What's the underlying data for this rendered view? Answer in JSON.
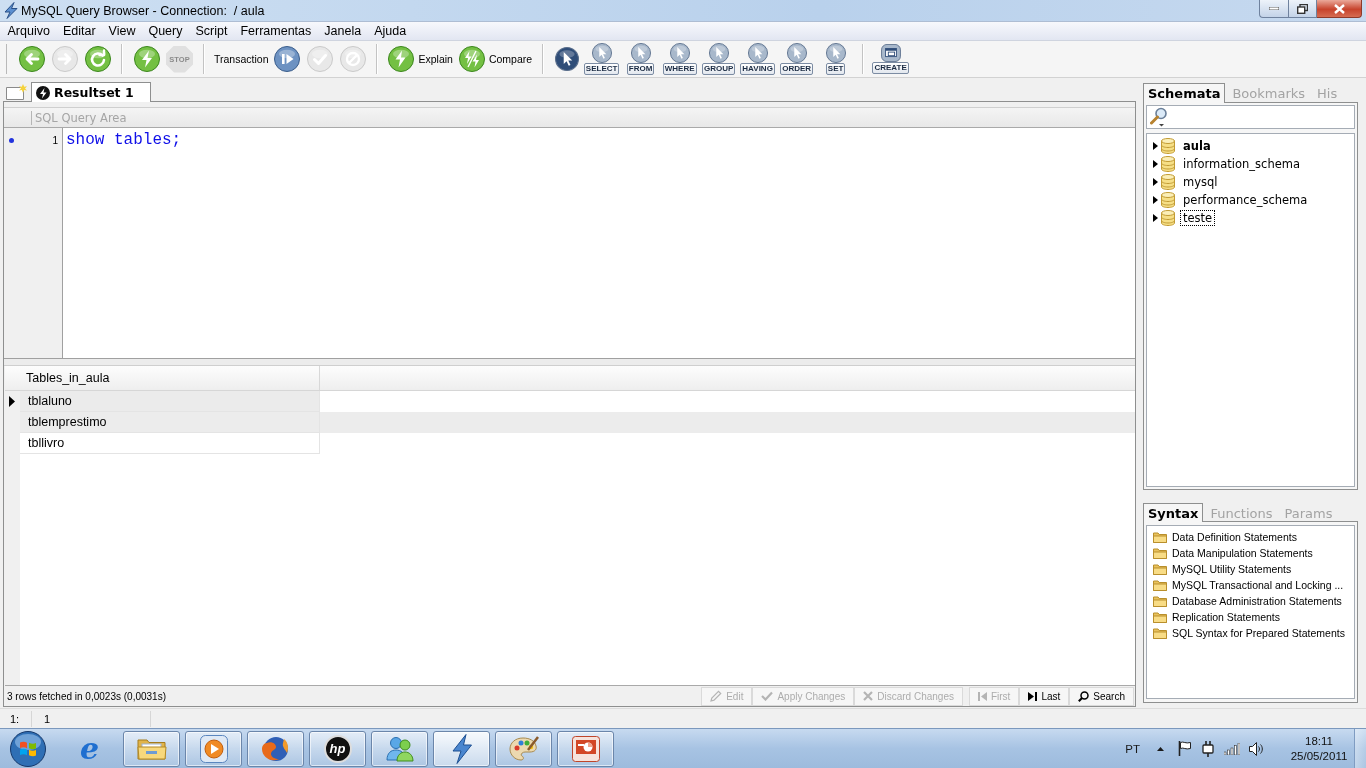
{
  "window": {
    "title": "MySQL Query Browser - Connection:  / aula"
  },
  "menu": [
    "Arquivo",
    "Editar",
    "View",
    "Query",
    "Script",
    "Ferramentas",
    "Janela",
    "Ajuda"
  ],
  "toolbar": {
    "groups": [
      [
        {
          "kind": "back",
          "disabled": false
        },
        {
          "kind": "forward",
          "disabled": true
        },
        {
          "kind": "refresh",
          "disabled": false
        }
      ],
      [
        {
          "kind": "execute",
          "disabled": false
        },
        {
          "kind": "stop",
          "badge": "STOP",
          "disabled": true
        }
      ],
      [
        {
          "kind": "text",
          "label": "Transaction"
        },
        {
          "kind": "start",
          "disabled": false
        },
        {
          "kind": "commit",
          "disabled": true
        },
        {
          "kind": "rollback",
          "disabled": true
        }
      ],
      [
        {
          "kind": "explain",
          "label": "Explain",
          "disabled": false
        },
        {
          "kind": "compare",
          "label": "Compare",
          "disabled": false
        }
      ],
      [
        {
          "kind": "pointer",
          "selected": true,
          "disabled": false
        },
        {
          "kind": "clause",
          "badge": "SELECT",
          "selected": false,
          "disabled": false
        },
        {
          "kind": "clause",
          "badge": "FROM",
          "selected": false,
          "disabled": false
        },
        {
          "kind": "clause",
          "badge": "WHERE",
          "selected": false,
          "disabled": false
        },
        {
          "kind": "clause",
          "badge": "GROUP",
          "selected": false,
          "disabled": false
        },
        {
          "kind": "clause",
          "badge": "HAVING",
          "selected": false,
          "disabled": false
        },
        {
          "kind": "clause",
          "badge": "ORDER",
          "selected": false,
          "disabled": false
        },
        {
          "kind": "clause",
          "badge": "SET",
          "selected": false,
          "disabled": false
        }
      ],
      [
        {
          "kind": "create",
          "badge": "CREATE",
          "disabled": false
        }
      ]
    ]
  },
  "result_tabs": [
    {
      "label": "Resultset 1",
      "selected": true
    }
  ],
  "query_area": {
    "header": "SQL Query Area",
    "lines": [
      {
        "number": "1",
        "text": "show tables;",
        "marked": true
      }
    ]
  },
  "result_grid": {
    "columns": [
      "Tables_in_aula"
    ],
    "rows": [
      {
        "cells": [
          "tblaluno"
        ],
        "selected": true
      },
      {
        "cells": [
          "tblemprestimo"
        ],
        "selected": false
      },
      {
        "cells": [
          "tbllivro"
        ],
        "selected": false
      }
    ]
  },
  "result_footer": {
    "status": "3 rows fetched in 0,0023s (0,0031s)",
    "buttons": [
      {
        "kind": "edit",
        "label": "Edit",
        "disabled": true
      },
      {
        "kind": "apply",
        "label": "Apply Changes",
        "disabled": true
      },
      {
        "kind": "discard",
        "label": "Discard Changes",
        "disabled": true
      },
      {
        "kind": "first",
        "label": "First",
        "disabled": true
      },
      {
        "kind": "last",
        "label": "Last",
        "disabled": false
      },
      {
        "kind": "search",
        "label": "Search",
        "disabled": false
      }
    ]
  },
  "schemata_panel": {
    "tabs": [
      {
        "label": "Schemata",
        "selected": true
      },
      {
        "label": "Bookmarks",
        "selected": false
      },
      {
        "label": "His",
        "selected": false
      }
    ],
    "tree": [
      {
        "label": "aula",
        "default": true,
        "focused": false,
        "expanded": false
      },
      {
        "label": "information_schema",
        "default": false,
        "focused": false,
        "expanded": false
      },
      {
        "label": "mysql",
        "default": false,
        "focused": false,
        "expanded": false
      },
      {
        "label": "performance_schema",
        "default": false,
        "focused": false,
        "expanded": false
      },
      {
        "label": "teste",
        "default": false,
        "focused": true,
        "expanded": false
      }
    ]
  },
  "syntax_panel": {
    "tabs": [
      {
        "label": "Syntax",
        "selected": true
      },
      {
        "label": "Functions",
        "selected": false
      },
      {
        "label": "Params",
        "selected": false
      }
    ],
    "items": [
      "Data Definition Statements",
      "Data Manipulation Statements",
      "MySQL Utility Statements",
      "MySQL Transactional and Locking ...",
      "Database Administration Statements",
      "Replication Statements",
      "SQL Syntax for Prepared Statements"
    ]
  },
  "status_bar": [
    "1:",
    "1"
  ],
  "taskbar": {
    "apps": [
      {
        "kind": "letter",
        "glyph": "e",
        "running": false,
        "active": false
      },
      {
        "kind": "folder",
        "running": true,
        "active": false
      },
      {
        "kind": "media",
        "running": true,
        "active": false
      },
      {
        "kind": "globe",
        "running": true,
        "active": false
      },
      {
        "kind": "logo",
        "glyph": "hp",
        "running": true,
        "active": false
      },
      {
        "kind": "people",
        "running": true,
        "active": false
      },
      {
        "kind": "lightning",
        "running": true,
        "active": true
      },
      {
        "kind": "palette",
        "running": true,
        "active": false
      },
      {
        "kind": "slides",
        "running": true,
        "active": false
      }
    ],
    "language": "PT",
    "time": "18:11",
    "date": "25/05/2011"
  }
}
